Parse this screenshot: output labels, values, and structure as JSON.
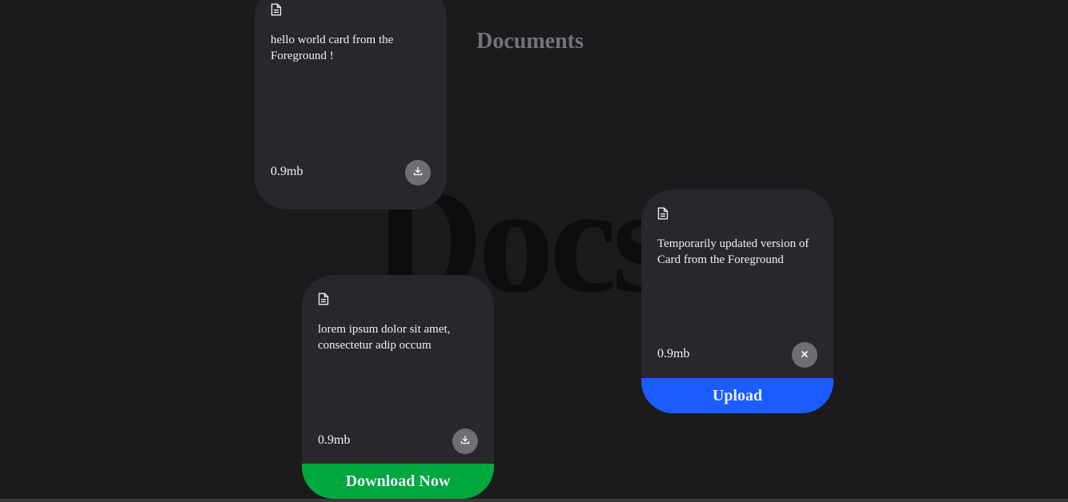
{
  "header": {
    "title": "Documents",
    "background_word": "Docs"
  },
  "cards": [
    {
      "description": "hello world card from the Foreground !",
      "file_size": "0.9mb",
      "action_icon": "download-icon",
      "tag": null
    },
    {
      "description": "lorem ipsum dolor sit amet, consectetur adip occum",
      "file_size": "0.9mb",
      "action_icon": "download-icon",
      "tag": {
        "label": "Download Now",
        "color": "#00a63e"
      }
    },
    {
      "description": "Temporarily updated version of Card from the Foreground",
      "file_size": "0.9mb",
      "action_icon": "close-icon",
      "tag": {
        "label": "Upload",
        "color": "#1a5cff"
      }
    }
  ],
  "colors": {
    "background": "#1b1b1d",
    "card": "#27272c",
    "action_button": "#6e6e73",
    "title": "#737378"
  }
}
